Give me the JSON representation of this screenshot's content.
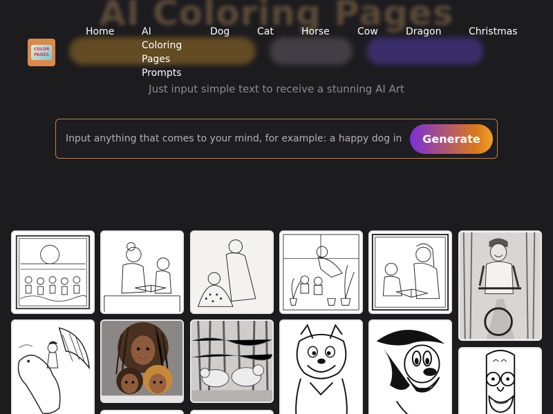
{
  "hero": {
    "background_title": "AI Coloring Pages",
    "tagline": "Just input simple text to receive a stunning AI Art"
  },
  "logo": {
    "text_line1": "COLOR",
    "text_line2": "PAGES"
  },
  "nav": {
    "items": [
      {
        "label": "Home"
      },
      {
        "label": "AI"
      },
      {
        "label": "Coloring"
      },
      {
        "label": "Pages"
      },
      {
        "label": "Prompts"
      },
      {
        "label": "Dog"
      },
      {
        "label": "Cat"
      },
      {
        "label": "Horse"
      },
      {
        "label": "Cow"
      },
      {
        "label": "Dragon"
      },
      {
        "label": "Christmas"
      }
    ]
  },
  "search": {
    "placeholder": "Input anything that comes to your mind, for example: a happy dog in",
    "value": "",
    "button_label": "Generate"
  },
  "gallery": {
    "items": [
      {
        "subject": "children-in-garden-scene",
        "style": "line-art"
      },
      {
        "subject": "grandmother-reading-with-girl",
        "style": "line-art"
      },
      {
        "subject": "grandmother-sewing-with-child",
        "style": "line-art"
      },
      {
        "subject": "mother-and-kids-gardening",
        "style": "line-art"
      },
      {
        "subject": "mother-and-child-reading",
        "style": "line-art"
      },
      {
        "subject": "boy-riding-bicycle-in-forest",
        "style": "pencil-shaded"
      },
      {
        "subject": "girl-riding-dragon",
        "style": "line-art"
      },
      {
        "subject": "mother-with-two-children",
        "style": "color-render"
      },
      {
        "subject": "bears-in-forest",
        "style": "pencil-shaded"
      },
      {
        "subject": "cartoon-fox-character",
        "style": "line-art"
      },
      {
        "subject": "cartoon-mouse-character",
        "style": "line-art"
      },
      {
        "subject": "cartoon-man-with-glasses",
        "style": "line-art"
      }
    ]
  },
  "colors": {
    "background": "#1c1b1e",
    "accent_orange": "#d9791f",
    "accent_purple": "#7b2fd6",
    "search_border": "#c08346",
    "tagline": "#8e8c92"
  }
}
